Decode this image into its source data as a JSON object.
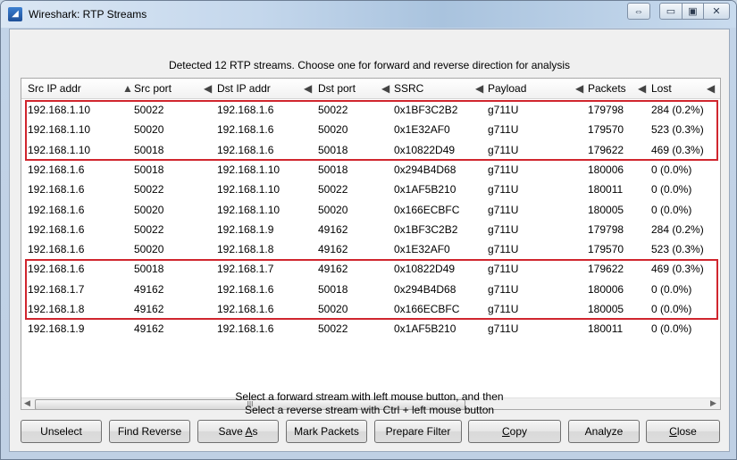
{
  "window": {
    "title": "Wireshark: RTP Streams",
    "swap_glyph": "⇔",
    "min_glyph": "▭",
    "max_glyph": "▣",
    "close_glyph": "✕"
  },
  "header": "Detected 12 RTP streams. Choose one for forward and reverse direction for analysis",
  "table": {
    "columns": [
      "Src IP addr",
      "Src port",
      "Dst IP addr",
      "Dst port",
      "SSRC",
      "Payload",
      "Packets",
      "Lost"
    ],
    "rows": [
      [
        "192.168.1.10",
        "50022",
        "192.168.1.6",
        "50022",
        "0x1BF3C2B2",
        "g711U",
        "179798",
        "284 (0.2%)"
      ],
      [
        "192.168.1.10",
        "50020",
        "192.168.1.6",
        "50020",
        "0x1E32AF0",
        "g711U",
        "179570",
        "523 (0.3%)"
      ],
      [
        "192.168.1.10",
        "50018",
        "192.168.1.6",
        "50018",
        "0x10822D49",
        "g711U",
        "179622",
        "469 (0.3%)"
      ],
      [
        "192.168.1.6",
        "50018",
        "192.168.1.10",
        "50018",
        "0x294B4D68",
        "g711U",
        "180006",
        "0 (0.0%)"
      ],
      [
        "192.168.1.6",
        "50022",
        "192.168.1.10",
        "50022",
        "0x1AF5B210",
        "g711U",
        "180011",
        "0 (0.0%)"
      ],
      [
        "192.168.1.6",
        "50020",
        "192.168.1.10",
        "50020",
        "0x166ECBFC",
        "g711U",
        "180005",
        "0 (0.0%)"
      ],
      [
        "192.168.1.6",
        "50022",
        "192.168.1.9",
        "49162",
        "0x1BF3C2B2",
        "g711U",
        "179798",
        "284 (0.2%)"
      ],
      [
        "192.168.1.6",
        "50020",
        "192.168.1.8",
        "49162",
        "0x1E32AF0",
        "g711U",
        "179570",
        "523 (0.3%)"
      ],
      [
        "192.168.1.6",
        "50018",
        "192.168.1.7",
        "49162",
        "0x10822D49",
        "g711U",
        "179622",
        "469 (0.3%)"
      ],
      [
        "192.168.1.7",
        "49162",
        "192.168.1.6",
        "50018",
        "0x294B4D68",
        "g711U",
        "180006",
        "0 (0.0%)"
      ],
      [
        "192.168.1.8",
        "49162",
        "192.168.1.6",
        "50020",
        "0x166ECBFC",
        "g711U",
        "180005",
        "0 (0.0%)"
      ],
      [
        "192.168.1.9",
        "49162",
        "192.168.1.6",
        "50022",
        "0x1AF5B210",
        "g711U",
        "180011",
        "0 (0.0%)"
      ]
    ],
    "scroll_thumb_grip": "III"
  },
  "hint": {
    "line1": "Select a forward stream with left mouse button, and then",
    "line2": "Select a reverse stream with Ctrl + left mouse button"
  },
  "buttons": {
    "unselect": "Unselect",
    "find_reverse": "Find Reverse",
    "save_as_pre": "Save ",
    "save_as_key": "A",
    "save_as_post": "s",
    "mark_packets": "Mark Packets",
    "prepare_filter": "Prepare Filter",
    "copy_key": "C",
    "copy_rest": "opy",
    "analyze": "Analyze",
    "close_key": "C",
    "close_rest": "lose"
  },
  "colors": {
    "highlight_border": "#d0262e"
  }
}
